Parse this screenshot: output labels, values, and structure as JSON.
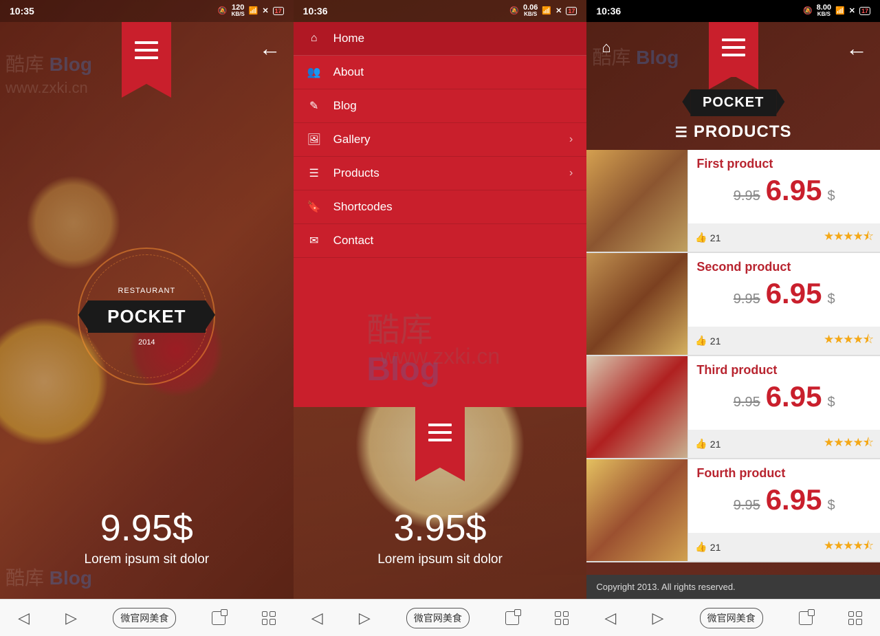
{
  "screens": {
    "left": {
      "statusbar": {
        "time": "10:35",
        "speed": "120",
        "speed_unit": "KB/S",
        "battery": "17"
      },
      "badge": {
        "restaurant": "RESTAURANT",
        "brand": "POCKET",
        "year": "2014"
      },
      "hero": {
        "price": "9.95$",
        "subtitle": "Lorem ipsum sit dolor"
      }
    },
    "middle": {
      "statusbar": {
        "time": "10:36",
        "speed": "0.06",
        "speed_unit": "KB/S",
        "battery": "17"
      },
      "menu": [
        {
          "icon": "home",
          "label": "Home",
          "expand": false
        },
        {
          "icon": "users",
          "label": "About",
          "expand": false
        },
        {
          "icon": "edit",
          "label": "Blog",
          "expand": false
        },
        {
          "icon": "image",
          "label": "Gallery",
          "expand": true
        },
        {
          "icon": "list",
          "label": "Products",
          "expand": true
        },
        {
          "icon": "tags",
          "label": "Shortcodes",
          "expand": false
        },
        {
          "icon": "mail",
          "label": "Contact",
          "expand": false
        }
      ],
      "hero": {
        "price": "3.95$",
        "subtitle": "Lorem ipsum sit dolor"
      }
    },
    "right": {
      "statusbar": {
        "time": "10:36",
        "speed": "8.00",
        "speed_unit": "KB/S",
        "battery": "17"
      },
      "brand": "POCKET",
      "section": "PRODUCTS",
      "products": [
        {
          "name": "First product",
          "old": "9.95",
          "new": "6.95",
          "currency": "$",
          "likes": "21"
        },
        {
          "name": "Second product",
          "old": "9.95",
          "new": "6.95",
          "currency": "$",
          "likes": "21"
        },
        {
          "name": "Third product",
          "old": "9.95",
          "new": "6.95",
          "currency": "$",
          "likes": "21"
        },
        {
          "name": "Fourth product",
          "old": "9.95",
          "new": "6.95",
          "currency": "$",
          "likes": "21"
        }
      ],
      "copyright": "Copyright 2013. All rights reserved."
    }
  },
  "nav_pill": "微官网美食",
  "watermark": {
    "a": "酷库",
    "b": "Blog",
    "c": "www.zxki.cn"
  }
}
